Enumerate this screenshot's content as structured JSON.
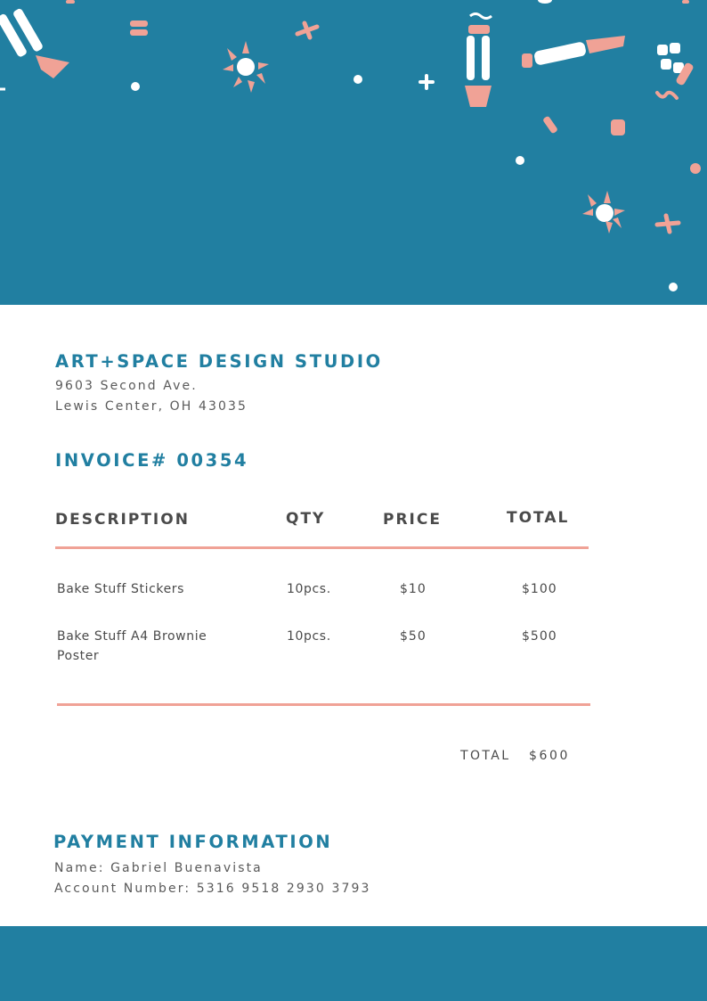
{
  "colors": {
    "brand_blue": "#217fa1",
    "accent_pink": "#f0a296",
    "text_dark": "#4a4a4a"
  },
  "company": {
    "name": "ART+SPACE DESIGN STUDIO",
    "address_line1": "9603 Second Ave.",
    "address_line2": "Lewis Center, OH 43035"
  },
  "invoice": {
    "number_label": "INVOICE# 00354"
  },
  "table": {
    "headers": {
      "description": "DESCRIPTION",
      "qty": "QTY",
      "price": "PRICE",
      "total": "TOTAL"
    },
    "rows": [
      {
        "description": "Bake Stuff Stickers",
        "qty": "10pcs.",
        "price": "$10",
        "total": "$100"
      },
      {
        "description": "Bake Stuff A4 Brownie Poster",
        "qty": "10pcs.",
        "price": "$50",
        "total": "$500"
      }
    ]
  },
  "summary": {
    "total_label": "TOTAL",
    "total_value": "$600"
  },
  "payment": {
    "title": "PAYMENT INFORMATION",
    "name_line": "Name: Gabriel Buenavista",
    "account_line": "Account Number: 5316 9518 2930 3793"
  },
  "decorations": [
    "paintbrush-icon",
    "sun-doodle-icon",
    "cross-doodle-icon",
    "dot-doodle-icon"
  ]
}
